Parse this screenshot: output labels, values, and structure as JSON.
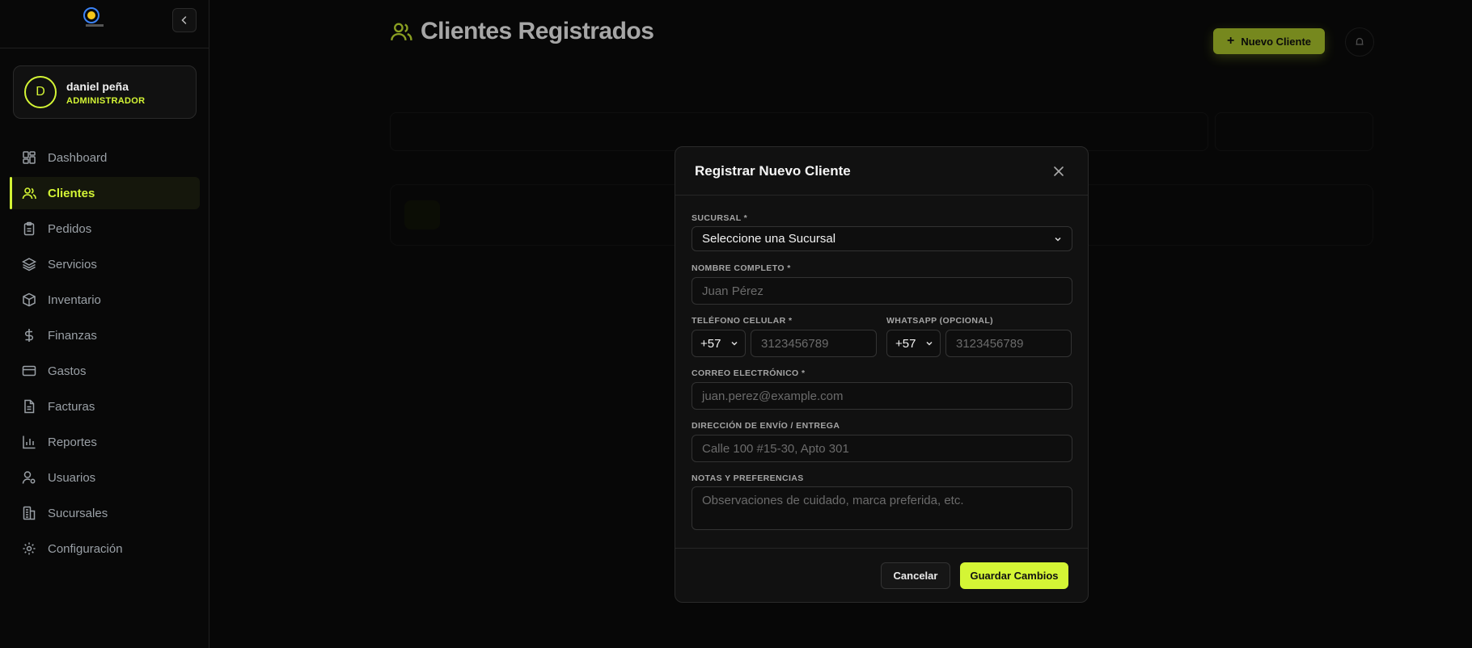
{
  "colors": {
    "accent": "#d4f535",
    "background": "#0b0b0b",
    "panel": "#111111"
  },
  "sidebar": {
    "user": {
      "initial": "D",
      "name": "daniel peña",
      "role": "ADMINISTRADOR"
    },
    "items": [
      {
        "label": "Dashboard",
        "icon": "dashboard-icon"
      },
      {
        "label": "Clientes",
        "icon": "users-icon",
        "active": true
      },
      {
        "label": "Pedidos",
        "icon": "clipboard-icon"
      },
      {
        "label": "Servicios",
        "icon": "layers-icon"
      },
      {
        "label": "Inventario",
        "icon": "box-icon"
      },
      {
        "label": "Finanzas",
        "icon": "dollar-icon"
      },
      {
        "label": "Gastos",
        "icon": "card-icon"
      },
      {
        "label": "Facturas",
        "icon": "file-icon"
      },
      {
        "label": "Reportes",
        "icon": "bar-chart-icon"
      },
      {
        "label": "Usuarios",
        "icon": "user-gear-icon"
      },
      {
        "label": "Sucursales",
        "icon": "building-icon"
      },
      {
        "label": "Configuración",
        "icon": "gear-icon"
      }
    ]
  },
  "header": {
    "title": "Clientes Registrados",
    "new_client_label": "Nuevo Cliente"
  },
  "modal": {
    "title": "Registrar Nuevo Cliente",
    "branch_label": "SUCURSAL *",
    "branch_value": "Seleccione una Sucursal",
    "name_label": "NOMBRE COMPLETO *",
    "name_placeholder": "Juan Pérez",
    "phone_label": "TELÉFONO CELULAR *",
    "phone_code": "+57",
    "phone_placeholder": "3123456789",
    "whatsapp_label": "WHATSAPP (OPCIONAL)",
    "whatsapp_code": "+57",
    "whatsapp_placeholder": "3123456789",
    "email_label": "CORREO ELECTRÓNICO *",
    "email_placeholder": "juan.perez@example.com",
    "address_label": "DIRECCIÓN DE ENVÍO / ENTREGA",
    "address_placeholder": "Calle 100 #15-30, Apto 301",
    "notes_label": "NOTAS Y PREFERENCIAS",
    "notes_placeholder": "Observaciones de cuidado, marca preferida, etc.",
    "cancel_label": "Cancelar",
    "save_label": "Guardar Cambios"
  }
}
